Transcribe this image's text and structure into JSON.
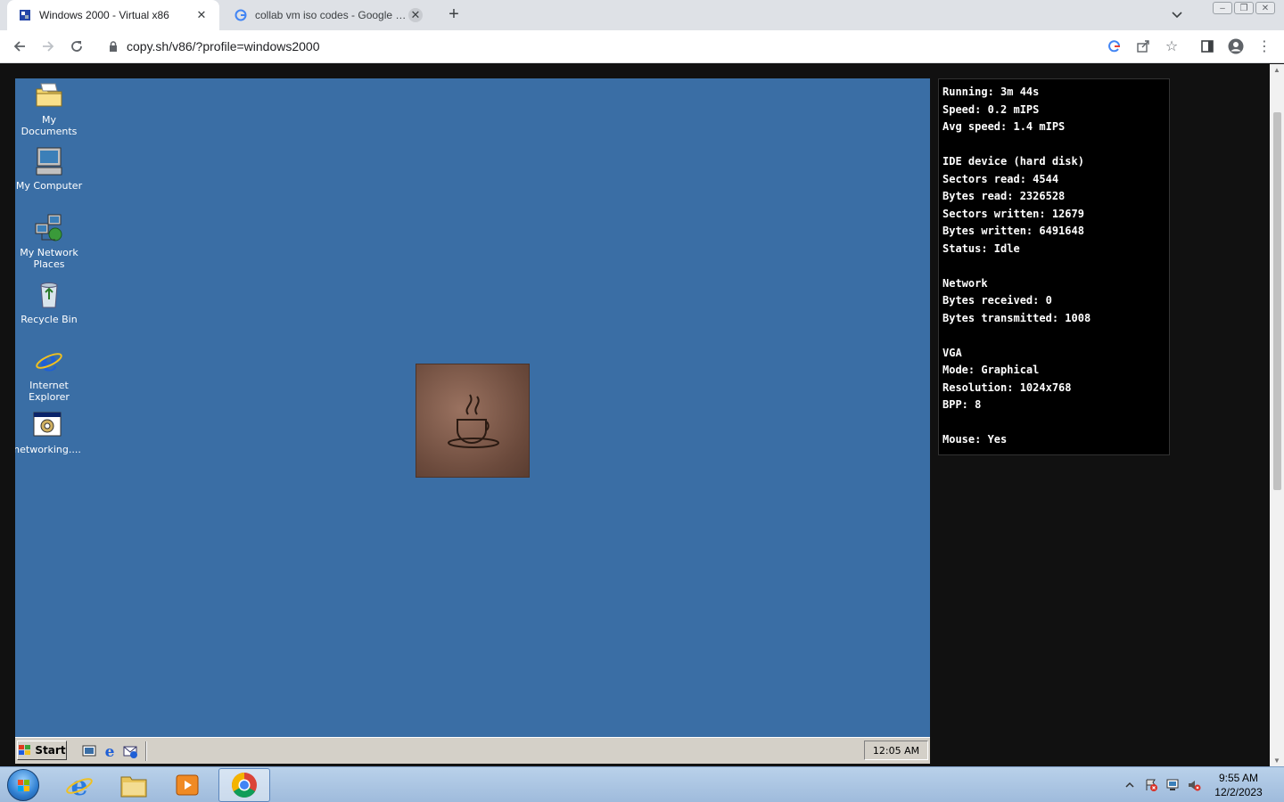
{
  "browser": {
    "tabs": [
      {
        "title": "Windows 2000 - Virtual x86",
        "active": true
      },
      {
        "title": "collab vm iso codes - Google Search",
        "active": false
      }
    ],
    "url": "copy.sh/v86/?profile=windows2000"
  },
  "desktop": {
    "icons": [
      {
        "label": "My Documents",
        "icon": "folder-icon"
      },
      {
        "label": "My Computer",
        "icon": "computer-icon"
      },
      {
        "label": "My Network Places",
        "icon": "network-icon"
      },
      {
        "label": "Recycle Bin",
        "icon": "recycle-bin-icon"
      },
      {
        "label": "Internet Explorer",
        "icon": "ie-icon"
      },
      {
        "label": "networking....",
        "icon": "program-icon"
      }
    ],
    "taskbar": {
      "start_label": "Start",
      "clock": "12:05 AM"
    }
  },
  "stats": {
    "running": "Running: 3m 44s",
    "speed": "Speed: 0.2 mIPS",
    "avg_speed": "Avg speed: 1.4 mIPS",
    "ide_heading": "IDE device (hard disk)",
    "sectors_read": "Sectors read: 4544",
    "bytes_read": "Bytes read: 2326528",
    "sectors_written": "Sectors written: 12679",
    "bytes_written": "Bytes written: 6491648",
    "status": "Status: Idle",
    "network_heading": "Network",
    "bytes_received": "Bytes received: 0",
    "bytes_transmitted": "Bytes transmitted: 1008",
    "vga_heading": "VGA",
    "mode": "Mode: Graphical",
    "resolution": "Resolution: 1024x768",
    "bpp": "BPP: 8",
    "mouse": "Mouse: Yes"
  },
  "host_taskbar": {
    "time": "9:55 AM",
    "date": "12/2/2023"
  }
}
